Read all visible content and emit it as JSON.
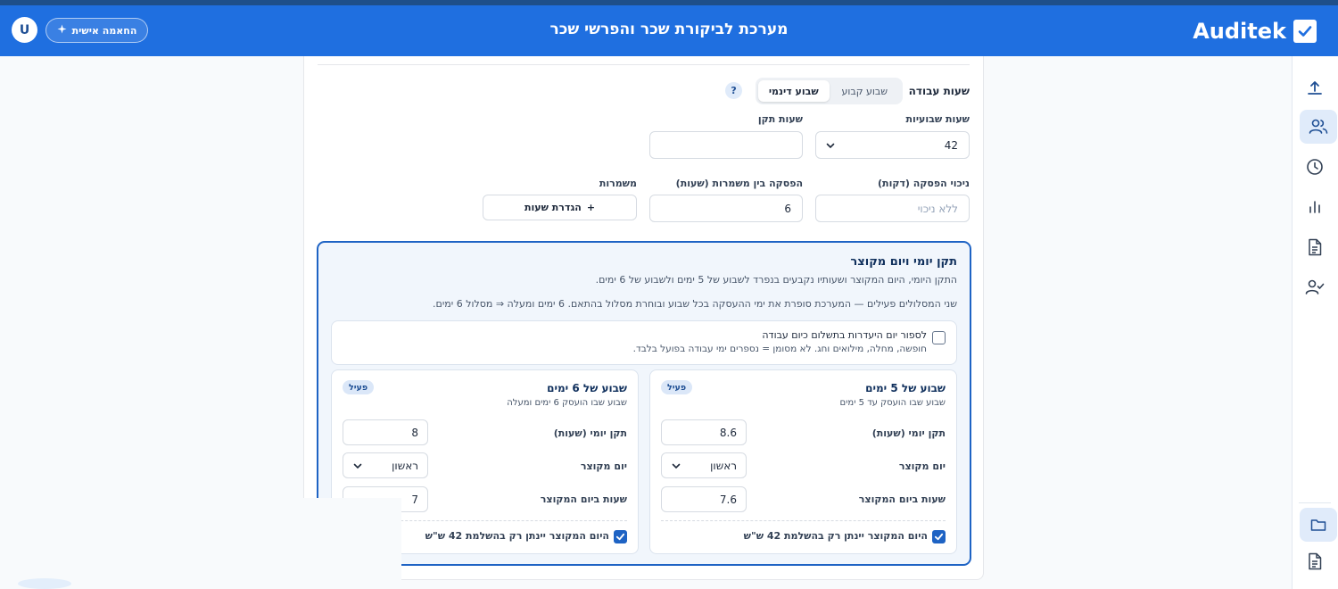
{
  "header": {
    "logo_text": "Auditek",
    "title": "מערכת לביקורת שכר והפרשי שכר",
    "personal_button": "החאמה אישית",
    "avatar_initial": "U"
  },
  "rail": {
    "icons": [
      "upload-icon",
      "users-icon",
      "clock-icon",
      "bar-chart-icon",
      "document-icon",
      "user-check-icon",
      "folder-icon",
      "file-text-icon"
    ],
    "active": "users-icon"
  },
  "work_hours": {
    "section_title": "שעות עבודה",
    "mode_options": [
      "שבוע קבוע",
      "שבוע דינמי"
    ],
    "selected_mode": "שבוע דינמי",
    "help": "?",
    "weekly_hours_label": "שעות שבועיות",
    "weekly_hours_value": "42",
    "standard_hours_label": "שעות תקן",
    "standard_hours_value": "",
    "break_deduction_label": "ניכוי הפסקה (דקות)",
    "break_deduction_placeholder": "ללא ניכוי",
    "shift_break_label": "הפסקה בין משמרות (שעות)",
    "shift_break_value": "6",
    "shifts_label": "משמרות",
    "define_hours_button": "הגדרת שעות",
    "define_hours_plus": "+"
  },
  "daily_panel": {
    "title": "תקן יומי ויום מקוצר",
    "desc1": "התקן היומי, היום המקוצר ושעותיו נקבעים בנפרד לשבוע של 5 ימים ולשבוע של 6 ימים.",
    "desc2": "שני המסלולים פעילים — המערכת סופרת את ימי ההעסקה בכל שבוע ובוחרת מסלול בהתאם. 6 ימים ומעלה ⇒ מסלול 6 ימים.",
    "absence_title": "לספור יום היעדרות בתשלום כיום עבודה",
    "absence_sub": "חופשה, מחלה, מילואים וחג. לא מסומן = נספרים ימי עבודה בפועל בלבד.",
    "absence_checked": false,
    "week5": {
      "title": "שבוע של 5 ימים",
      "subtitle": "שבוע שבו הועסק עד 5 ימים",
      "badge": "פעיל",
      "daily_label": "תקן יומי (שעות)",
      "daily_value": "8.6",
      "short_day_label": "יום מקוצר",
      "short_day_value": "ראשון",
      "short_hours_label": "שעות ביום המקוצר",
      "short_hours_value": "7.6",
      "only_42_label": "היום המקוצר יינתן רק בהשלמת 42 ש\"ש",
      "only_42_checked": true
    },
    "week6": {
      "title": "שבוע של 6 ימים",
      "subtitle": "שבוע שבו הועסק 6 ימים ומעלה",
      "badge": "פעיל",
      "daily_label": "תקן יומי (שעות)",
      "daily_value": "8",
      "short_day_label": "יום מקוצר",
      "short_day_value": "ראשון",
      "short_hours_label": "שעות ביום המקוצר",
      "short_hours_value": "7",
      "only_42_label": "היום המקוצר יינתן רק בהשלמת 42 ש\"ש",
      "only_42_checked": true
    }
  },
  "colors": {
    "header_blue": "#1f6fe0",
    "accent": "#1e63c4",
    "panel_bg": "#f1f6fc"
  }
}
